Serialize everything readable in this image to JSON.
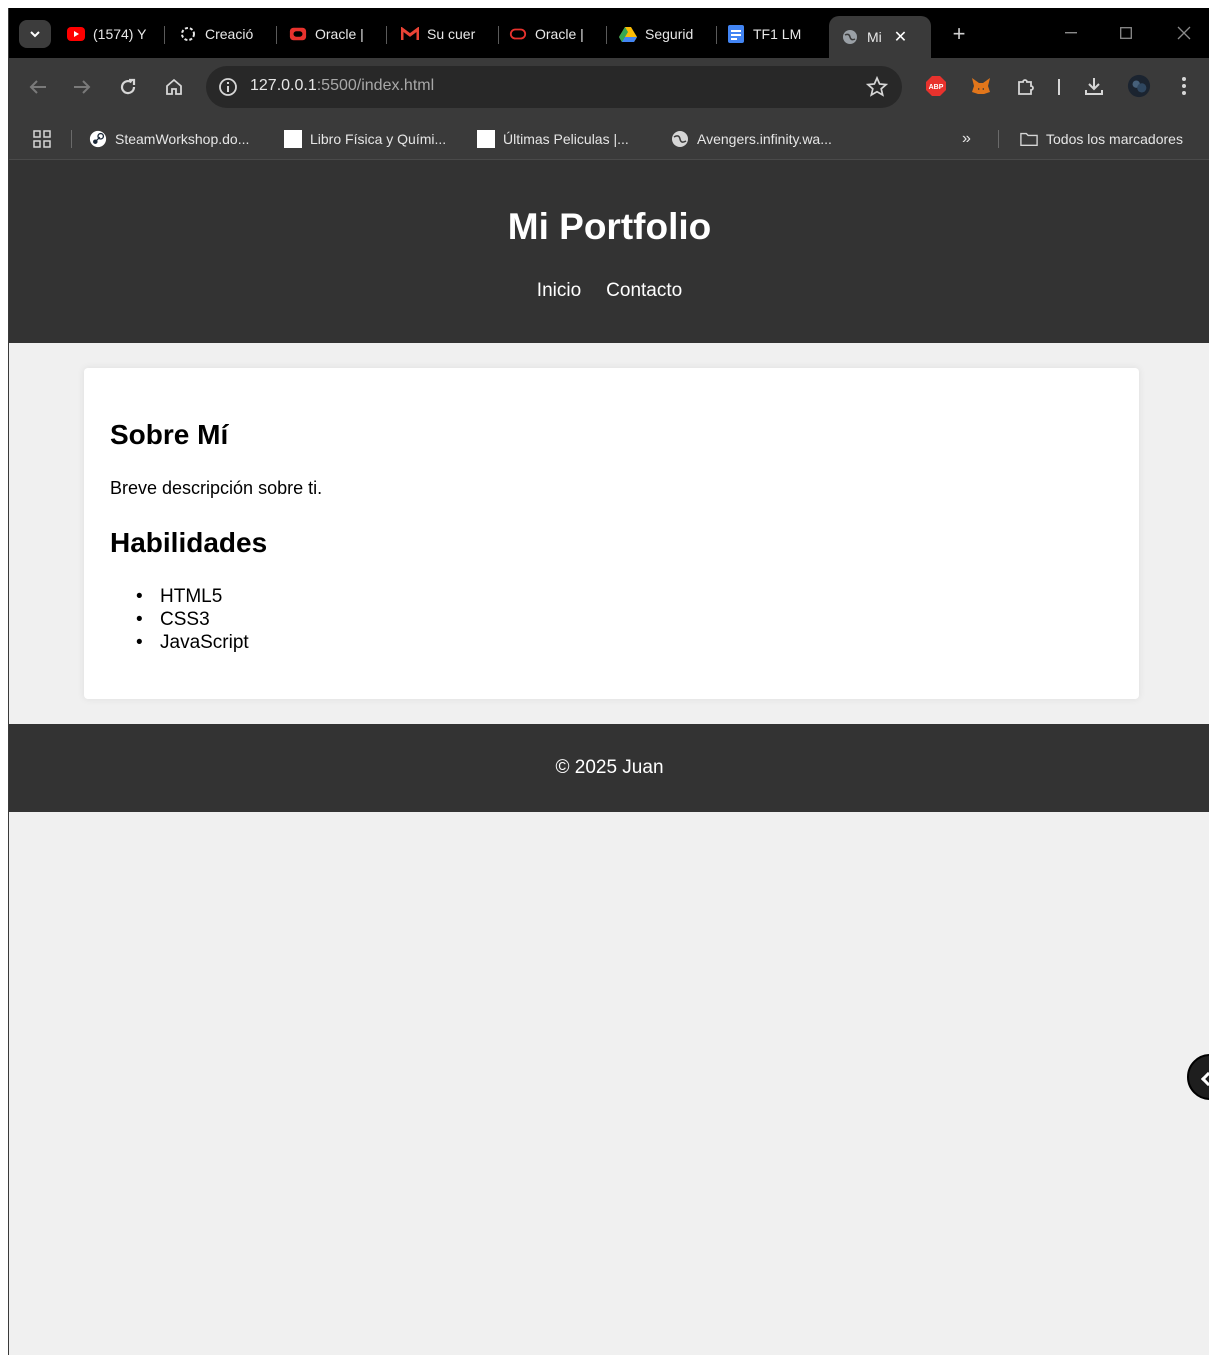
{
  "browser": {
    "tabs": [
      {
        "label": "(1574) Y",
        "icon": "youtube-icon",
        "color": "#ff0000"
      },
      {
        "label": "Creació",
        "icon": "openai-icon",
        "color": "#ffffff"
      },
      {
        "label": "Oracle |",
        "icon": "oracle-icon",
        "color": "#e8322d"
      },
      {
        "label": "Su cuer",
        "icon": "gmail-icon",
        "color": "#ea4335"
      },
      {
        "label": "Oracle |",
        "icon": "oracle-outline-icon",
        "color": "#e8322d"
      },
      {
        "label": "Segurid",
        "icon": "google-drive-icon",
        "color": "#fbbc04"
      },
      {
        "label": "TF1 LM",
        "icon": "google-docs-icon",
        "color": "#4285f4"
      },
      {
        "label": "Mi",
        "icon": "globe-icon",
        "color": "#9aa0a6",
        "active": true
      }
    ],
    "close_glyph": "✕",
    "new_tab_glyph": "+",
    "url_host": "127.0.0.1",
    "url_rest": ":5500/index.html",
    "bookmarks": [
      {
        "label": "SteamWorkshop.do...",
        "icon": "steam-icon"
      },
      {
        "label": "Libro Física y Quími...",
        "icon": "blank-page-icon"
      },
      {
        "label": "Últimas Peliculas |...",
        "icon": "blank-page-icon"
      },
      {
        "label": "Avengers.infinity.wa...",
        "icon": "globe-icon"
      }
    ],
    "bookmarks_overflow": "»",
    "all_bookmarks": "Todos los marcadores",
    "abp_label": "ABP"
  },
  "site": {
    "title": "Mi Portfolio",
    "nav": [
      "Inicio",
      "Contacto"
    ],
    "about_heading": "Sobre Mí",
    "about_text": "Breve descripción sobre ti.",
    "skills_heading": "Habilidades",
    "skills": [
      "HTML5",
      "CSS3",
      "JavaScript"
    ],
    "footer": "© 2025 Juan"
  },
  "colors": {
    "header_bg": "#333333",
    "page_bg": "#f0f0f0",
    "card_bg": "#ffffff"
  }
}
